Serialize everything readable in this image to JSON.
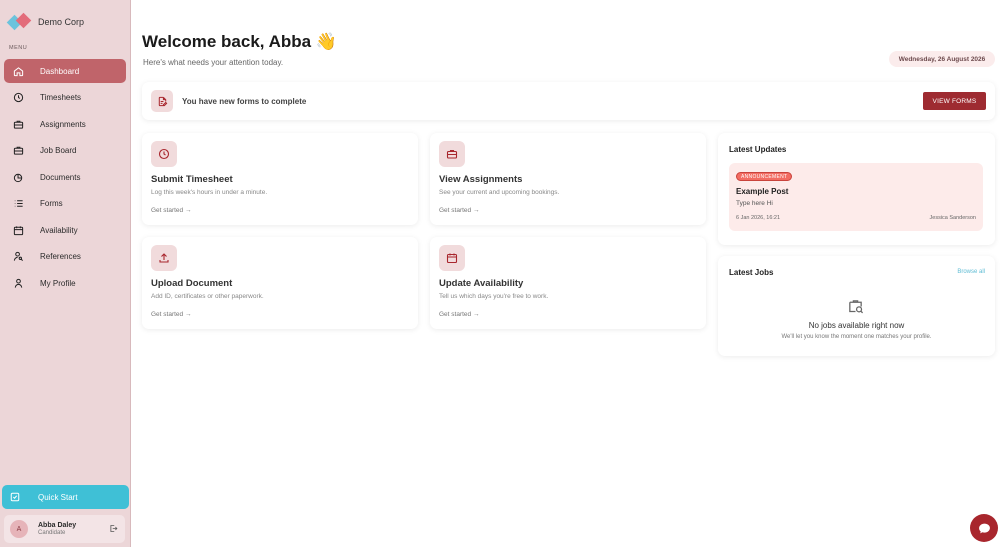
{
  "brand": {
    "name": "Demo Corp"
  },
  "sidebar": {
    "menu_label": "MENU",
    "items": [
      {
        "label": "Dashboard",
        "icon": "home-icon",
        "active": true
      },
      {
        "label": "Timesheets",
        "icon": "clock-icon"
      },
      {
        "label": "Assignments",
        "icon": "briefcase-icon"
      },
      {
        "label": "Job Board",
        "icon": "briefcase-icon"
      },
      {
        "label": "Documents",
        "icon": "documents-icon"
      },
      {
        "label": "Forms",
        "icon": "list-icon"
      },
      {
        "label": "Availability",
        "icon": "calendar-icon"
      },
      {
        "label": "References",
        "icon": "user-search-icon"
      },
      {
        "label": "My Profile",
        "icon": "user-icon"
      }
    ],
    "quick_start": "Quick Start",
    "user": {
      "initial": "A",
      "name": "Abba Daley",
      "role": "Candidate"
    }
  },
  "header": {
    "welcome": "Welcome back, Abba 👋",
    "subtitle": "Here's what needs your attention today.",
    "date": "Wednesday, 26 August 2026"
  },
  "banner": {
    "text": "You have new forms to complete",
    "button": "VIEW FORMS"
  },
  "actions": [
    {
      "title": "Submit Timesheet",
      "desc": "Log this week's hours in under a minute.",
      "cta": "Get started →",
      "icon": "clock-icon"
    },
    {
      "title": "View Assignments",
      "desc": "See your current and upcoming bookings.",
      "cta": "Get started →",
      "icon": "briefcase-icon"
    },
    {
      "title": "Upload Document",
      "desc": "Add ID, certificates or other paperwork.",
      "cta": "Get started →",
      "icon": "upload-icon"
    },
    {
      "title": "Update Availability",
      "desc": "Tell us which days you're free to work.",
      "cta": "Get started →",
      "icon": "calendar-icon"
    }
  ],
  "updates": {
    "title": "Latest Updates",
    "post": {
      "badge": "ANNOUNCEMENT",
      "title": "Example Post",
      "body": "Type here Hi",
      "time": "6 Jan 2026, 16:21",
      "author": "Jessica Sanderson"
    }
  },
  "jobs": {
    "title": "Latest Jobs",
    "browse": "Browse all",
    "empty_title": "No jobs available right now",
    "empty_sub": "We'll let you know the moment one matches your profile."
  },
  "colors": {
    "sidebar_bg": "#ecd6d8",
    "active_nav": "#c0646a",
    "accent_cyan": "#3fc0d6",
    "primary_button": "#9e2b31",
    "badge": "#f26c62"
  }
}
